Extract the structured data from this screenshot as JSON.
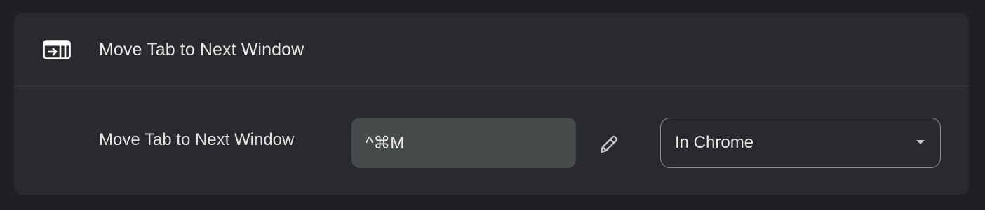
{
  "command": {
    "title": "Move Tab to Next Window",
    "icon": "move-tab-window-icon"
  },
  "shortcut_row": {
    "label": "Move Tab to Next Window",
    "shortcut_value": "^⌘M",
    "edit_icon": "pencil-icon",
    "scope_selected": "In Chrome",
    "scope_icon": "chevron-down-icon"
  },
  "colors": {
    "background": "#1f2023",
    "card": "#292a2d",
    "shortcut_box": "#474a4b",
    "text": "#e3e3e3",
    "border": "#8e8f93"
  }
}
